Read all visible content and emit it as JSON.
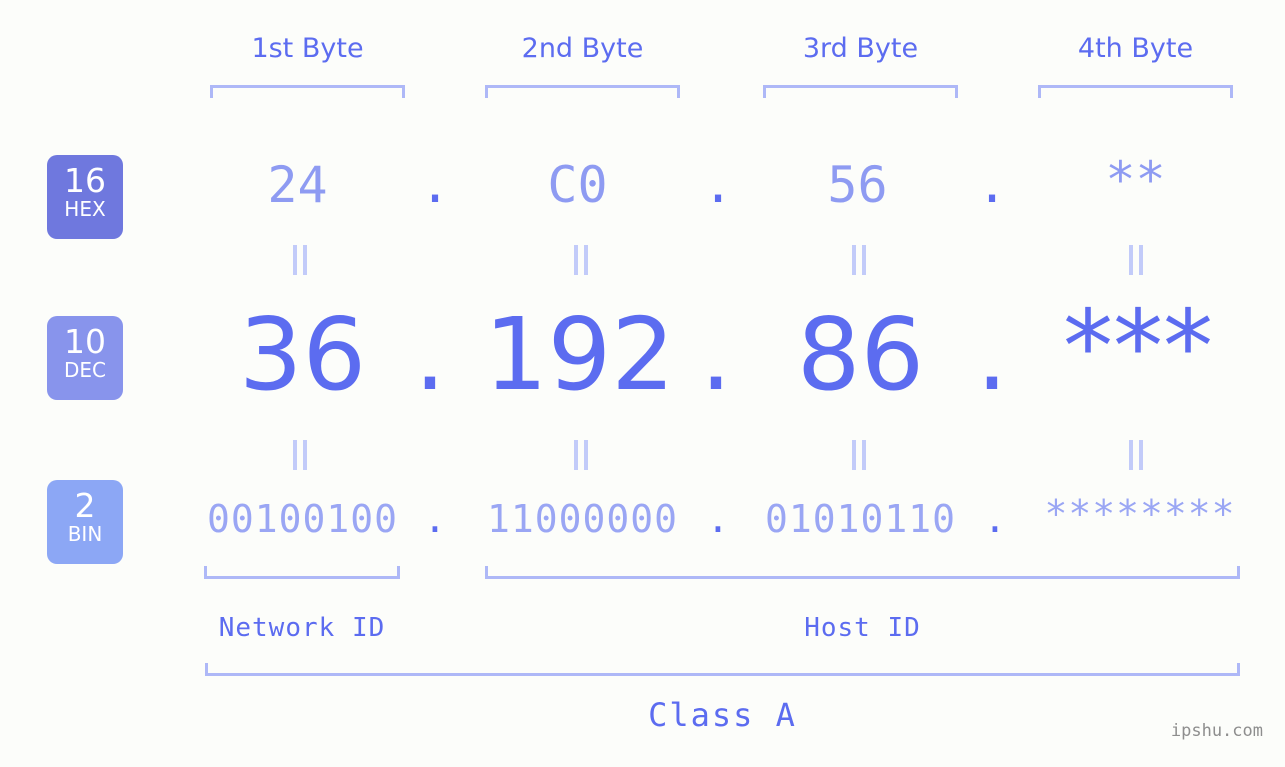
{
  "background_color": "#fcfdfa",
  "accent_color": "#5c6cf0",
  "bracket_color": "#aeb8f7",
  "headers": {
    "byte1": "1st Byte",
    "byte2": "2nd Byte",
    "byte3": "3rd Byte",
    "byte4": "4th Byte"
  },
  "bases": {
    "hex": {
      "number": "16",
      "name": "HEX",
      "color": "#6f78de"
    },
    "dec": {
      "number": "10",
      "name": "DEC",
      "color": "#8894ec"
    },
    "bin": {
      "number": "2",
      "name": "BIN",
      "color": "#8ca7f5"
    }
  },
  "separator": ".",
  "equals_symbol": "=",
  "rows": {
    "hex": {
      "b1": "24",
      "b2": "C0",
      "b3": "56",
      "b4": "**"
    },
    "dec": {
      "b1": "36",
      "b2": "192",
      "b3": "86",
      "b4": "***"
    },
    "bin": {
      "b1": "00100100",
      "b2": "11000000",
      "b3": "01010110",
      "b4": "********"
    }
  },
  "segments": {
    "network_id": "Network ID",
    "host_id": "Host ID",
    "class": "Class A"
  },
  "watermark": "ipshu.com"
}
